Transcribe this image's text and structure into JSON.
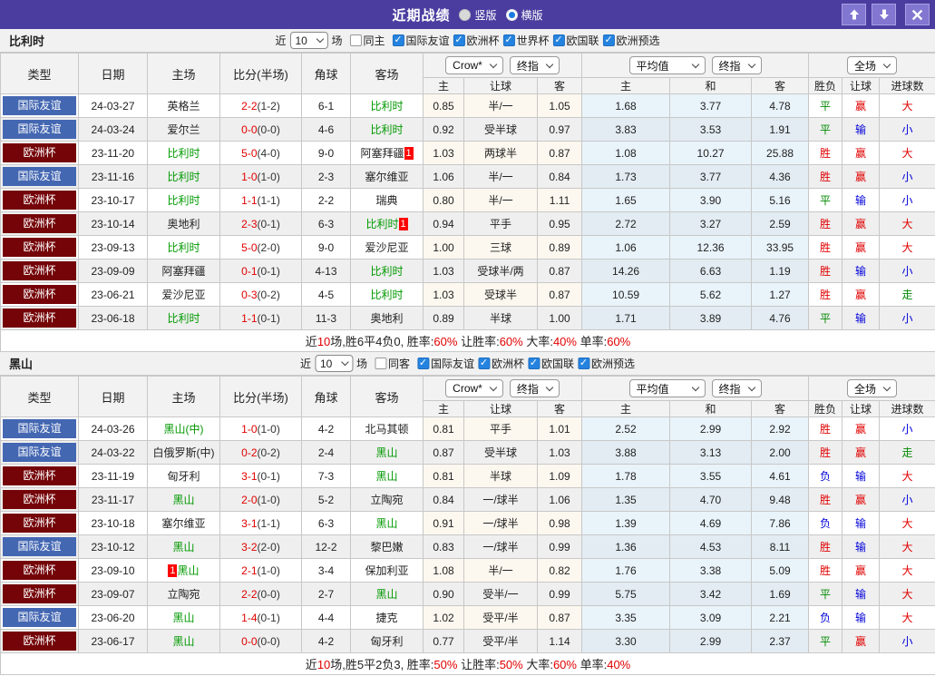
{
  "colors": {
    "titlebar_purple": "#4b3da0",
    "button_purple": "#8176d0",
    "friendly_blue": "#4467b2",
    "cup_maroon": "#740408",
    "team_green": "#009900",
    "score_red": "#e10000",
    "loss_blue": "#0000d9",
    "draw_green": "#008a00",
    "checkbox_blue": "#2583e0"
  },
  "titlebar": {
    "title": "近期战绩",
    "layout_options": [
      {
        "label": "竖版",
        "selected": false
      },
      {
        "label": "横版",
        "selected": true
      }
    ]
  },
  "filters": {
    "near_label": "近",
    "count": "10",
    "games_label": "场"
  },
  "table_header": {
    "cols": {
      "type": "类型",
      "date": "日期",
      "home": "主场",
      "score": "比分(半场)",
      "corner": "角球",
      "away": "客场"
    },
    "selects": {
      "bookmaker": "Crow*",
      "final1": "终指",
      "average": "平均值",
      "final2": "终指",
      "fulltime": "全场"
    },
    "sub": {
      "h": "主",
      "handicap": "让球",
      "a": "客",
      "avg_h": "主",
      "avg_d": "和",
      "avg_a": "客",
      "wdl": "胜负",
      "let": "让球",
      "goals": "进球数"
    }
  },
  "sections": [
    {
      "team": "比利时",
      "same_filter": {
        "label": "同主",
        "checked": false
      },
      "competitions": [
        {
          "label": "国际友谊",
          "checked": true
        },
        {
          "label": "欧洲杯",
          "checked": true
        },
        {
          "label": "世界杯",
          "checked": true
        },
        {
          "label": "欧国联",
          "checked": true
        },
        {
          "label": "欧洲预选",
          "checked": true
        }
      ],
      "rows": [
        {
          "type": "国际友谊",
          "style": "friendly",
          "date": "24-03-27",
          "home": {
            "text": "英格兰",
            "green": false
          },
          "score": "2-2",
          "half": "(1-2)",
          "corner": "6-1",
          "away": {
            "text": "比利时",
            "green": true
          },
          "odds": [
            "0.85",
            "半/一",
            "1.05"
          ],
          "avg": [
            "1.68",
            "3.77",
            "4.78"
          ],
          "res": [
            {
              "t": "平",
              "c": "g"
            },
            {
              "t": "赢",
              "c": "r"
            },
            {
              "t": "大",
              "c": "r"
            }
          ]
        },
        {
          "type": "国际友谊",
          "style": "friendly",
          "date": "24-03-24",
          "home": {
            "text": "爱尔兰",
            "green": false
          },
          "score": "0-0",
          "half": "(0-0)",
          "corner": "4-6",
          "away": {
            "text": "比利时",
            "green": true
          },
          "odds": [
            "0.92",
            "受半球",
            "0.97"
          ],
          "avg": [
            "3.83",
            "3.53",
            "1.91"
          ],
          "res": [
            {
              "t": "平",
              "c": "g"
            },
            {
              "t": "输",
              "c": "b"
            },
            {
              "t": "小",
              "c": "b"
            }
          ]
        },
        {
          "type": "欧洲杯",
          "style": "cup",
          "date": "23-11-20",
          "home": {
            "text": "比利时",
            "green": true
          },
          "score": "5-0",
          "half": "(4-0)",
          "corner": "9-0",
          "away": {
            "text": "阿塞拜疆",
            "green": false,
            "badge": "1",
            "badge_pos": "after"
          },
          "odds": [
            "1.03",
            "两球半",
            "0.87"
          ],
          "avg": [
            "1.08",
            "10.27",
            "25.88"
          ],
          "res": [
            {
              "t": "胜",
              "c": "r"
            },
            {
              "t": "赢",
              "c": "r"
            },
            {
              "t": "大",
              "c": "r"
            }
          ]
        },
        {
          "type": "国际友谊",
          "style": "friendly",
          "date": "23-11-16",
          "home": {
            "text": "比利时",
            "green": true
          },
          "score": "1-0",
          "half": "(1-0)",
          "corner": "2-3",
          "away": {
            "text": "塞尔维亚",
            "green": false
          },
          "odds": [
            "1.06",
            "半/一",
            "0.84"
          ],
          "avg": [
            "1.73",
            "3.77",
            "4.36"
          ],
          "res": [
            {
              "t": "胜",
              "c": "r"
            },
            {
              "t": "赢",
              "c": "r"
            },
            {
              "t": "小",
              "c": "b"
            }
          ]
        },
        {
          "type": "欧洲杯",
          "style": "cup",
          "date": "23-10-17",
          "home": {
            "text": "比利时",
            "green": true
          },
          "score": "1-1",
          "half": "(1-1)",
          "corner": "2-2",
          "away": {
            "text": "瑞典",
            "green": false
          },
          "odds": [
            "0.80",
            "半/一",
            "1.11"
          ],
          "avg": [
            "1.65",
            "3.90",
            "5.16"
          ],
          "res": [
            {
              "t": "平",
              "c": "g"
            },
            {
              "t": "输",
              "c": "b"
            },
            {
              "t": "小",
              "c": "b"
            }
          ]
        },
        {
          "type": "欧洲杯",
          "style": "cup",
          "date": "23-10-14",
          "home": {
            "text": "奥地利",
            "green": false
          },
          "score": "2-3",
          "half": "(0-1)",
          "corner": "6-3",
          "away": {
            "text": "比利时",
            "green": true,
            "badge": "1",
            "badge_pos": "after"
          },
          "odds": [
            "0.94",
            "平手",
            "0.95"
          ],
          "avg": [
            "2.72",
            "3.27",
            "2.59"
          ],
          "res": [
            {
              "t": "胜",
              "c": "r"
            },
            {
              "t": "赢",
              "c": "r"
            },
            {
              "t": "大",
              "c": "r"
            }
          ]
        },
        {
          "type": "欧洲杯",
          "style": "cup",
          "date": "23-09-13",
          "home": {
            "text": "比利时",
            "green": true
          },
          "score": "5-0",
          "half": "(2-0)",
          "corner": "9-0",
          "away": {
            "text": "爱沙尼亚",
            "green": false
          },
          "odds": [
            "1.00",
            "三球",
            "0.89"
          ],
          "avg": [
            "1.06",
            "12.36",
            "33.95"
          ],
          "res": [
            {
              "t": "胜",
              "c": "r"
            },
            {
              "t": "赢",
              "c": "r"
            },
            {
              "t": "大",
              "c": "r"
            }
          ]
        },
        {
          "type": "欧洲杯",
          "style": "cup",
          "date": "23-09-09",
          "home": {
            "text": "阿塞拜疆",
            "green": false
          },
          "score": "0-1",
          "half": "(0-1)",
          "corner": "4-13",
          "away": {
            "text": "比利时",
            "green": true
          },
          "odds": [
            "1.03",
            "受球半/两",
            "0.87"
          ],
          "avg": [
            "14.26",
            "6.63",
            "1.19"
          ],
          "res": [
            {
              "t": "胜",
              "c": "r"
            },
            {
              "t": "输",
              "c": "b"
            },
            {
              "t": "小",
              "c": "b"
            }
          ]
        },
        {
          "type": "欧洲杯",
          "style": "cup",
          "date": "23-06-21",
          "home": {
            "text": "爱沙尼亚",
            "green": false
          },
          "score": "0-3",
          "half": "(0-2)",
          "corner": "4-5",
          "away": {
            "text": "比利时",
            "green": true
          },
          "odds": [
            "1.03",
            "受球半",
            "0.87"
          ],
          "avg": [
            "10.59",
            "5.62",
            "1.27"
          ],
          "res": [
            {
              "t": "胜",
              "c": "r"
            },
            {
              "t": "赢",
              "c": "r"
            },
            {
              "t": "走",
              "c": "g"
            }
          ]
        },
        {
          "type": "欧洲杯",
          "style": "cup",
          "date": "23-06-18",
          "home": {
            "text": "比利时",
            "green": true
          },
          "score": "1-1",
          "half": "(0-1)",
          "corner": "11-3",
          "away": {
            "text": "奥地利",
            "green": false
          },
          "odds": [
            "0.89",
            "半球",
            "1.00"
          ],
          "avg": [
            "1.71",
            "3.89",
            "4.76"
          ],
          "res": [
            {
              "t": "平",
              "c": "g"
            },
            {
              "t": "输",
              "c": "b"
            },
            {
              "t": "小",
              "c": "b"
            }
          ]
        }
      ],
      "summary": [
        {
          "t": "近",
          "c": "dark"
        },
        {
          "t": "10",
          "c": "red"
        },
        {
          "t": "场,胜6平4负0, 胜率:",
          "c": "dark"
        },
        {
          "t": "60%",
          "c": "red"
        },
        {
          "t": " 让胜率:",
          "c": "dark"
        },
        {
          "t": "60%",
          "c": "red"
        },
        {
          "t": " 大率:",
          "c": "dark"
        },
        {
          "t": "40%",
          "c": "red"
        },
        {
          "t": " 单率:",
          "c": "dark"
        },
        {
          "t": "60%",
          "c": "red"
        }
      ]
    },
    {
      "team": "黑山",
      "same_filter": {
        "label": "同客",
        "checked": false
      },
      "competitions": [
        {
          "label": "国际友谊",
          "checked": true
        },
        {
          "label": "欧洲杯",
          "checked": true
        },
        {
          "label": "欧国联",
          "checked": true
        },
        {
          "label": "欧洲预选",
          "checked": true
        }
      ],
      "rows": [
        {
          "type": "国际友谊",
          "style": "friendly",
          "date": "24-03-26",
          "home": {
            "text": "黑山(中)",
            "green": true
          },
          "score": "1-0",
          "half": "(1-0)",
          "corner": "4-2",
          "away": {
            "text": "北马其顿",
            "green": false
          },
          "odds": [
            "0.81",
            "平手",
            "1.01"
          ],
          "avg": [
            "2.52",
            "2.99",
            "2.92"
          ],
          "res": [
            {
              "t": "胜",
              "c": "r"
            },
            {
              "t": "赢",
              "c": "r"
            },
            {
              "t": "小",
              "c": "b"
            }
          ]
        },
        {
          "type": "国际友谊",
          "style": "friendly",
          "date": "24-03-22",
          "home": {
            "text": "白俄罗斯(中)",
            "green": false
          },
          "score": "0-2",
          "half": "(0-2)",
          "corner": "2-4",
          "away": {
            "text": "黑山",
            "green": true
          },
          "odds": [
            "0.87",
            "受半球",
            "1.03"
          ],
          "avg": [
            "3.88",
            "3.13",
            "2.00"
          ],
          "res": [
            {
              "t": "胜",
              "c": "r"
            },
            {
              "t": "赢",
              "c": "r"
            },
            {
              "t": "走",
              "c": "g"
            }
          ]
        },
        {
          "type": "欧洲杯",
          "style": "cup",
          "date": "23-11-19",
          "home": {
            "text": "匈牙利",
            "green": false
          },
          "score": "3-1",
          "half": "(0-1)",
          "corner": "7-3",
          "away": {
            "text": "黑山",
            "green": true
          },
          "odds": [
            "0.81",
            "半球",
            "1.09"
          ],
          "avg": [
            "1.78",
            "3.55",
            "4.61"
          ],
          "res": [
            {
              "t": "负",
              "c": "b"
            },
            {
              "t": "输",
              "c": "b"
            },
            {
              "t": "大",
              "c": "r"
            }
          ]
        },
        {
          "type": "欧洲杯",
          "style": "cup",
          "date": "23-11-17",
          "home": {
            "text": "黑山",
            "green": true
          },
          "score": "2-0",
          "half": "(1-0)",
          "corner": "5-2",
          "away": {
            "text": "立陶宛",
            "green": false
          },
          "odds": [
            "0.84",
            "一/球半",
            "1.06"
          ],
          "avg": [
            "1.35",
            "4.70",
            "9.48"
          ],
          "res": [
            {
              "t": "胜",
              "c": "r"
            },
            {
              "t": "赢",
              "c": "r"
            },
            {
              "t": "小",
              "c": "b"
            }
          ]
        },
        {
          "type": "欧洲杯",
          "style": "cup",
          "date": "23-10-18",
          "home": {
            "text": "塞尔维亚",
            "green": false
          },
          "score": "3-1",
          "half": "(1-1)",
          "corner": "6-3",
          "away": {
            "text": "黑山",
            "green": true
          },
          "odds": [
            "0.91",
            "一/球半",
            "0.98"
          ],
          "avg": [
            "1.39",
            "4.69",
            "7.86"
          ],
          "res": [
            {
              "t": "负",
              "c": "b"
            },
            {
              "t": "输",
              "c": "b"
            },
            {
              "t": "大",
              "c": "r"
            }
          ]
        },
        {
          "type": "国际友谊",
          "style": "friendly",
          "date": "23-10-12",
          "home": {
            "text": "黑山",
            "green": true
          },
          "score": "3-2",
          "half": "(2-0)",
          "corner": "12-2",
          "away": {
            "text": "黎巴嫩",
            "green": false
          },
          "odds": [
            "0.83",
            "一/球半",
            "0.99"
          ],
          "avg": [
            "1.36",
            "4.53",
            "8.11"
          ],
          "res": [
            {
              "t": "胜",
              "c": "r"
            },
            {
              "t": "输",
              "c": "b"
            },
            {
              "t": "大",
              "c": "r"
            }
          ]
        },
        {
          "type": "欧洲杯",
          "style": "cup",
          "date": "23-09-10",
          "home": {
            "text": "黑山",
            "green": true,
            "badge": "1",
            "badge_pos": "before"
          },
          "score": "2-1",
          "half": "(1-0)",
          "corner": "3-4",
          "away": {
            "text": "保加利亚",
            "green": false
          },
          "odds": [
            "1.08",
            "半/一",
            "0.82"
          ],
          "avg": [
            "1.76",
            "3.38",
            "5.09"
          ],
          "res": [
            {
              "t": "胜",
              "c": "r"
            },
            {
              "t": "赢",
              "c": "r"
            },
            {
              "t": "大",
              "c": "r"
            }
          ]
        },
        {
          "type": "欧洲杯",
          "style": "cup",
          "date": "23-09-07",
          "home": {
            "text": "立陶宛",
            "green": false
          },
          "score": "2-2",
          "half": "(0-0)",
          "corner": "2-7",
          "away": {
            "text": "黑山",
            "green": true
          },
          "odds": [
            "0.90",
            "受半/一",
            "0.99"
          ],
          "avg": [
            "5.75",
            "3.42",
            "1.69"
          ],
          "res": [
            {
              "t": "平",
              "c": "g"
            },
            {
              "t": "输",
              "c": "b"
            },
            {
              "t": "大",
              "c": "r"
            }
          ]
        },
        {
          "type": "国际友谊",
          "style": "friendly",
          "date": "23-06-20",
          "home": {
            "text": "黑山",
            "green": true
          },
          "score": "1-4",
          "half": "(0-1)",
          "corner": "4-4",
          "away": {
            "text": "捷克",
            "green": false
          },
          "odds": [
            "1.02",
            "受平/半",
            "0.87"
          ],
          "avg": [
            "3.35",
            "3.09",
            "2.21"
          ],
          "res": [
            {
              "t": "负",
              "c": "b"
            },
            {
              "t": "输",
              "c": "b"
            },
            {
              "t": "大",
              "c": "r"
            }
          ]
        },
        {
          "type": "欧洲杯",
          "style": "cup",
          "date": "23-06-17",
          "home": {
            "text": "黑山",
            "green": true
          },
          "score": "0-0",
          "half": "(0-0)",
          "corner": "4-2",
          "away": {
            "text": "匈牙利",
            "green": false
          },
          "odds": [
            "0.77",
            "受平/半",
            "1.14"
          ],
          "avg": [
            "3.30",
            "2.99",
            "2.37"
          ],
          "res": [
            {
              "t": "平",
              "c": "g"
            },
            {
              "t": "赢",
              "c": "r"
            },
            {
              "t": "小",
              "c": "b"
            }
          ]
        }
      ],
      "summary": [
        {
          "t": "近",
          "c": "dark"
        },
        {
          "t": "10",
          "c": "red"
        },
        {
          "t": "场,胜5平2负3, 胜率:",
          "c": "dark"
        },
        {
          "t": "50%",
          "c": "red"
        },
        {
          "t": " 让胜率:",
          "c": "dark"
        },
        {
          "t": "50%",
          "c": "red"
        },
        {
          "t": " 大率:",
          "c": "dark"
        },
        {
          "t": "60%",
          "c": "red"
        },
        {
          "t": " 单率:",
          "c": "dark"
        },
        {
          "t": "40%",
          "c": "red"
        }
      ]
    }
  ]
}
